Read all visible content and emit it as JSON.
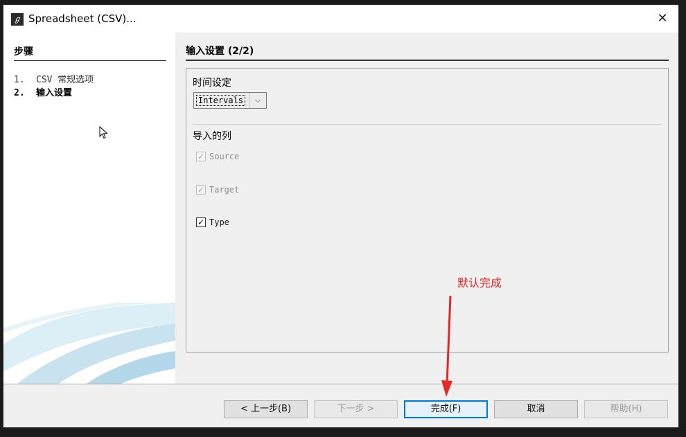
{
  "window": {
    "title": "Spreadsheet (CSV)..."
  },
  "steps": {
    "title": "步骤",
    "items": [
      {
        "num": "1.",
        "label": "CSV 常规选项"
      },
      {
        "num": "2.",
        "label": "输入设置"
      }
    ]
  },
  "content": {
    "title": "输入设置 (2/2)",
    "time_section": {
      "label": "时间设定",
      "selected": "Intervals"
    },
    "columns_section": {
      "label": "导入的列",
      "columns": [
        {
          "label": "Source",
          "checked": true,
          "enabled": false
        },
        {
          "label": "Target",
          "checked": true,
          "enabled": false
        },
        {
          "label": "Type",
          "checked": true,
          "enabled": true
        }
      ]
    }
  },
  "buttons": {
    "back": "< 上一步(B)",
    "next": "下一步 >",
    "finish": "完成(F)",
    "cancel": "取消",
    "help": "帮助(H)"
  },
  "annotation": {
    "text": "默认完成",
    "color": "#e32828"
  },
  "icons": {
    "close": "close-icon",
    "dropdown": "chevron-down-icon",
    "check": "checkmark-icon"
  }
}
